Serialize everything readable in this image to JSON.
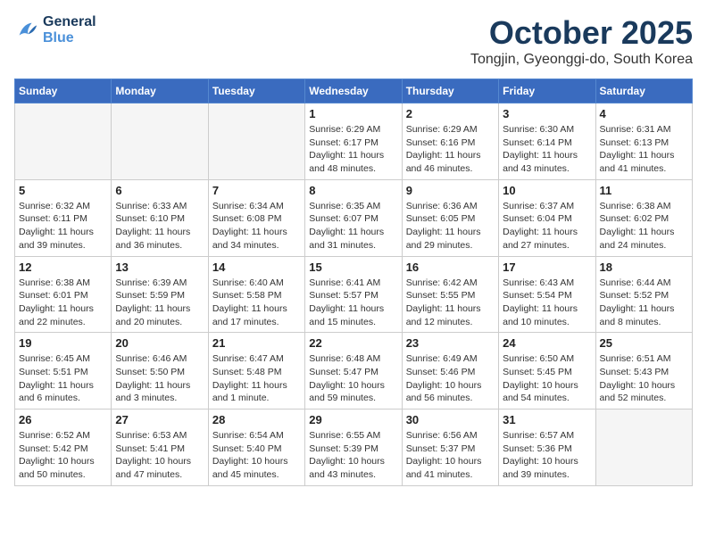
{
  "header": {
    "logo_line1": "General",
    "logo_line2": "Blue",
    "month": "October 2025",
    "location": "Tongjin, Gyeonggi-do, South Korea"
  },
  "weekdays": [
    "Sunday",
    "Monday",
    "Tuesday",
    "Wednesday",
    "Thursday",
    "Friday",
    "Saturday"
  ],
  "weeks": [
    [
      {
        "day": "",
        "sunrise": "",
        "sunset": "",
        "daylight": ""
      },
      {
        "day": "",
        "sunrise": "",
        "sunset": "",
        "daylight": ""
      },
      {
        "day": "",
        "sunrise": "",
        "sunset": "",
        "daylight": ""
      },
      {
        "day": "1",
        "sunrise": "Sunrise: 6:29 AM",
        "sunset": "Sunset: 6:17 PM",
        "daylight": "Daylight: 11 hours and 48 minutes."
      },
      {
        "day": "2",
        "sunrise": "Sunrise: 6:29 AM",
        "sunset": "Sunset: 6:16 PM",
        "daylight": "Daylight: 11 hours and 46 minutes."
      },
      {
        "day": "3",
        "sunrise": "Sunrise: 6:30 AM",
        "sunset": "Sunset: 6:14 PM",
        "daylight": "Daylight: 11 hours and 43 minutes."
      },
      {
        "day": "4",
        "sunrise": "Sunrise: 6:31 AM",
        "sunset": "Sunset: 6:13 PM",
        "daylight": "Daylight: 11 hours and 41 minutes."
      }
    ],
    [
      {
        "day": "5",
        "sunrise": "Sunrise: 6:32 AM",
        "sunset": "Sunset: 6:11 PM",
        "daylight": "Daylight: 11 hours and 39 minutes."
      },
      {
        "day": "6",
        "sunrise": "Sunrise: 6:33 AM",
        "sunset": "Sunset: 6:10 PM",
        "daylight": "Daylight: 11 hours and 36 minutes."
      },
      {
        "day": "7",
        "sunrise": "Sunrise: 6:34 AM",
        "sunset": "Sunset: 6:08 PM",
        "daylight": "Daylight: 11 hours and 34 minutes."
      },
      {
        "day": "8",
        "sunrise": "Sunrise: 6:35 AM",
        "sunset": "Sunset: 6:07 PM",
        "daylight": "Daylight: 11 hours and 31 minutes."
      },
      {
        "day": "9",
        "sunrise": "Sunrise: 6:36 AM",
        "sunset": "Sunset: 6:05 PM",
        "daylight": "Daylight: 11 hours and 29 minutes."
      },
      {
        "day": "10",
        "sunrise": "Sunrise: 6:37 AM",
        "sunset": "Sunset: 6:04 PM",
        "daylight": "Daylight: 11 hours and 27 minutes."
      },
      {
        "day": "11",
        "sunrise": "Sunrise: 6:38 AM",
        "sunset": "Sunset: 6:02 PM",
        "daylight": "Daylight: 11 hours and 24 minutes."
      }
    ],
    [
      {
        "day": "12",
        "sunrise": "Sunrise: 6:38 AM",
        "sunset": "Sunset: 6:01 PM",
        "daylight": "Daylight: 11 hours and 22 minutes."
      },
      {
        "day": "13",
        "sunrise": "Sunrise: 6:39 AM",
        "sunset": "Sunset: 5:59 PM",
        "daylight": "Daylight: 11 hours and 20 minutes."
      },
      {
        "day": "14",
        "sunrise": "Sunrise: 6:40 AM",
        "sunset": "Sunset: 5:58 PM",
        "daylight": "Daylight: 11 hours and 17 minutes."
      },
      {
        "day": "15",
        "sunrise": "Sunrise: 6:41 AM",
        "sunset": "Sunset: 5:57 PM",
        "daylight": "Daylight: 11 hours and 15 minutes."
      },
      {
        "day": "16",
        "sunrise": "Sunrise: 6:42 AM",
        "sunset": "Sunset: 5:55 PM",
        "daylight": "Daylight: 11 hours and 12 minutes."
      },
      {
        "day": "17",
        "sunrise": "Sunrise: 6:43 AM",
        "sunset": "Sunset: 5:54 PM",
        "daylight": "Daylight: 11 hours and 10 minutes."
      },
      {
        "day": "18",
        "sunrise": "Sunrise: 6:44 AM",
        "sunset": "Sunset: 5:52 PM",
        "daylight": "Daylight: 11 hours and 8 minutes."
      }
    ],
    [
      {
        "day": "19",
        "sunrise": "Sunrise: 6:45 AM",
        "sunset": "Sunset: 5:51 PM",
        "daylight": "Daylight: 11 hours and 6 minutes."
      },
      {
        "day": "20",
        "sunrise": "Sunrise: 6:46 AM",
        "sunset": "Sunset: 5:50 PM",
        "daylight": "Daylight: 11 hours and 3 minutes."
      },
      {
        "day": "21",
        "sunrise": "Sunrise: 6:47 AM",
        "sunset": "Sunset: 5:48 PM",
        "daylight": "Daylight: 11 hours and 1 minute."
      },
      {
        "day": "22",
        "sunrise": "Sunrise: 6:48 AM",
        "sunset": "Sunset: 5:47 PM",
        "daylight": "Daylight: 10 hours and 59 minutes."
      },
      {
        "day": "23",
        "sunrise": "Sunrise: 6:49 AM",
        "sunset": "Sunset: 5:46 PM",
        "daylight": "Daylight: 10 hours and 56 minutes."
      },
      {
        "day": "24",
        "sunrise": "Sunrise: 6:50 AM",
        "sunset": "Sunset: 5:45 PM",
        "daylight": "Daylight: 10 hours and 54 minutes."
      },
      {
        "day": "25",
        "sunrise": "Sunrise: 6:51 AM",
        "sunset": "Sunset: 5:43 PM",
        "daylight": "Daylight: 10 hours and 52 minutes."
      }
    ],
    [
      {
        "day": "26",
        "sunrise": "Sunrise: 6:52 AM",
        "sunset": "Sunset: 5:42 PM",
        "daylight": "Daylight: 10 hours and 50 minutes."
      },
      {
        "day": "27",
        "sunrise": "Sunrise: 6:53 AM",
        "sunset": "Sunset: 5:41 PM",
        "daylight": "Daylight: 10 hours and 47 minutes."
      },
      {
        "day": "28",
        "sunrise": "Sunrise: 6:54 AM",
        "sunset": "Sunset: 5:40 PM",
        "daylight": "Daylight: 10 hours and 45 minutes."
      },
      {
        "day": "29",
        "sunrise": "Sunrise: 6:55 AM",
        "sunset": "Sunset: 5:39 PM",
        "daylight": "Daylight: 10 hours and 43 minutes."
      },
      {
        "day": "30",
        "sunrise": "Sunrise: 6:56 AM",
        "sunset": "Sunset: 5:37 PM",
        "daylight": "Daylight: 10 hours and 41 minutes."
      },
      {
        "day": "31",
        "sunrise": "Sunrise: 6:57 AM",
        "sunset": "Sunset: 5:36 PM",
        "daylight": "Daylight: 10 hours and 39 minutes."
      },
      {
        "day": "",
        "sunrise": "",
        "sunset": "",
        "daylight": ""
      }
    ]
  ]
}
